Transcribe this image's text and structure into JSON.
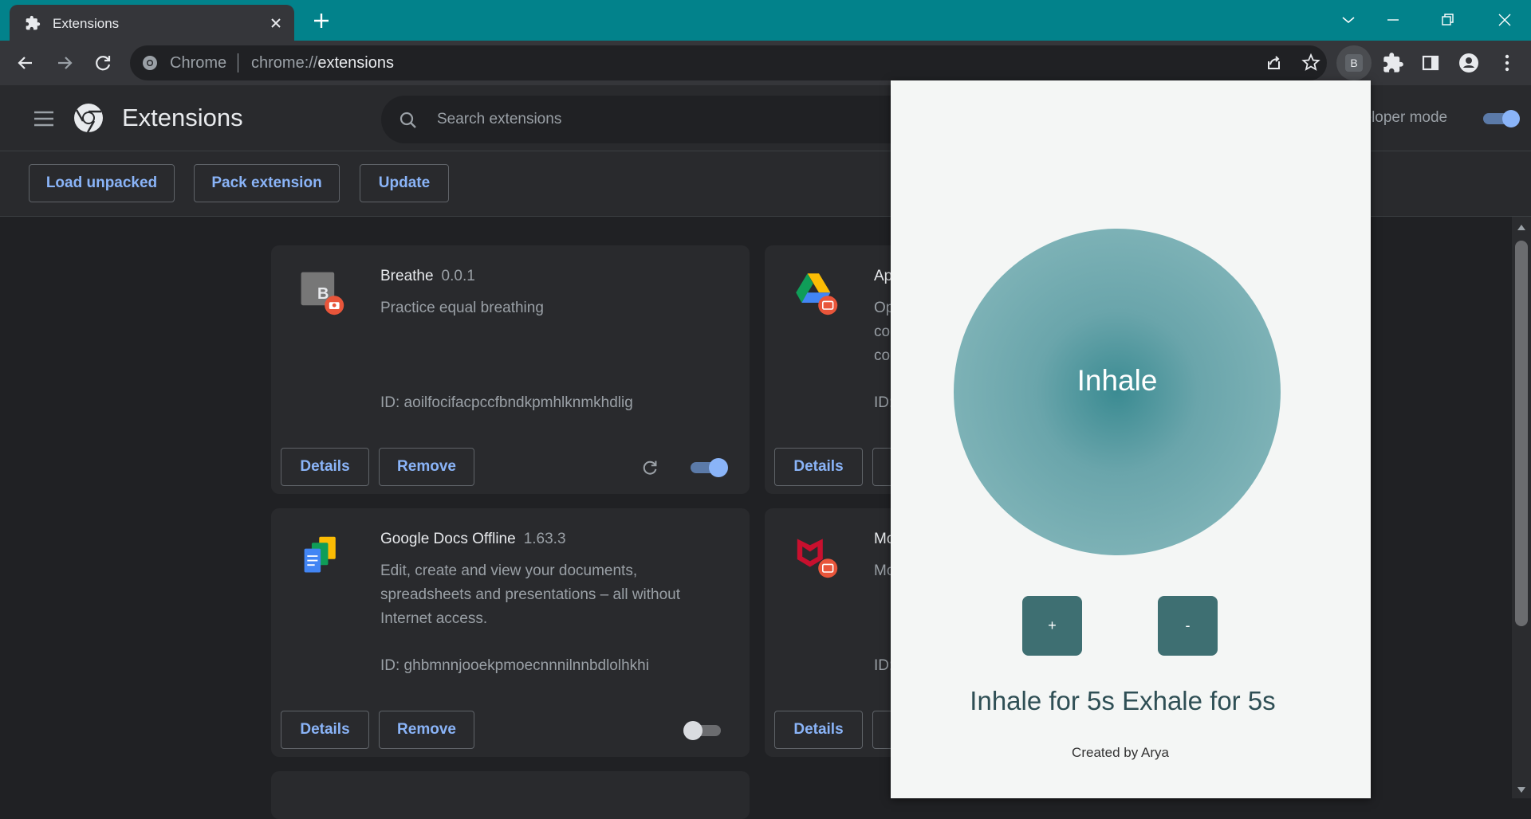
{
  "tab": {
    "title": "Extensions"
  },
  "omnibox": {
    "site_name": "Chrome",
    "url_scheme": "chrome://",
    "url_host": "extensions"
  },
  "toolbar": {
    "profile_badge": "B"
  },
  "header": {
    "title": "Extensions",
    "search_placeholder": "Search extensions",
    "dev_mode_label": "veloper mode",
    "dev_mode_on": true
  },
  "actions": {
    "load_unpacked": "Load unpacked",
    "pack_extension": "Pack extension",
    "update": "Update"
  },
  "cards": [
    {
      "name": "Breathe",
      "version": "0.0.1",
      "description": "Practice equal breathing",
      "id": "ID: aoilfocifacpccfbndkpmhlknmkhdlig",
      "details": "Details",
      "remove": "Remove",
      "enabled": true,
      "icon_letter": "B"
    },
    {
      "name": "Ap",
      "version": "",
      "description": "Op co co",
      "id": "ID:",
      "details": "Details",
      "remove": "",
      "enabled": true
    },
    {
      "name": "Google Docs Offline",
      "version": "1.63.3",
      "description": "Edit, create and view your documents, spreadsheets and presentations – all without Internet access.",
      "id": "ID: ghbmnnjooekpmoecnnnilnnbdlolhkhi",
      "details": "Details",
      "remove": "Remove",
      "enabled": false
    },
    {
      "name": "Mc",
      "version": "",
      "description": "Mc",
      "id": "ID:",
      "details": "Details",
      "remove": "",
      "enabled": true
    }
  ],
  "popup": {
    "breath_state": "Inhale",
    "plus": "+",
    "minus": "-",
    "timing": "Inhale for 5s Exhale for 5s",
    "credit": "Created by Arya"
  },
  "colors": {
    "titlebar": "#02828b",
    "accent": "#8ab4f8",
    "circle": "#6aa5ab",
    "popup_button": "#3e6f72"
  }
}
